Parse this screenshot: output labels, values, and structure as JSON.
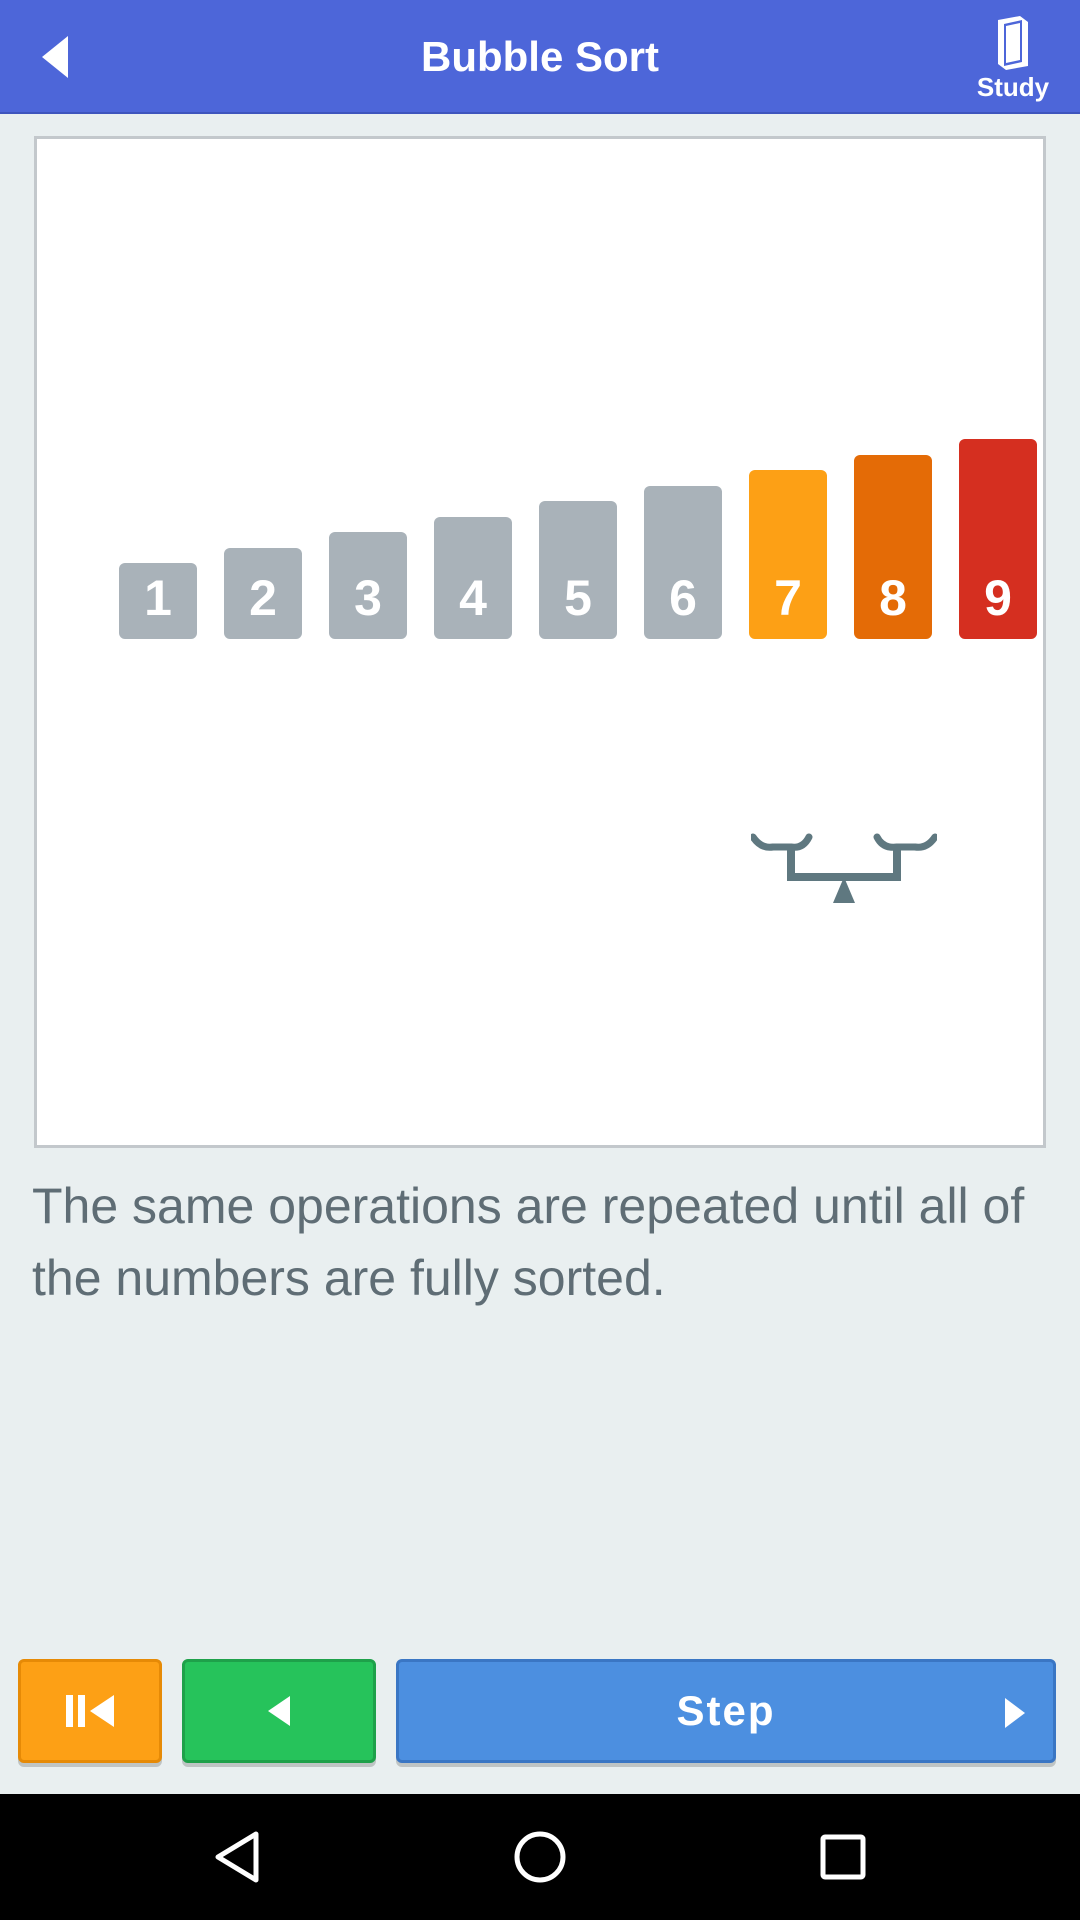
{
  "header": {
    "title": "Bubble Sort",
    "back_icon": "back-arrow-icon",
    "study_label": "Study",
    "study_icon": "book-icon"
  },
  "visualization": {
    "numbers": [
      {
        "label": "1",
        "value": 1,
        "color": "#a9b2b9"
      },
      {
        "label": "2",
        "value": 2,
        "color": "#a9b2b9"
      },
      {
        "label": "3",
        "value": 3,
        "color": "#a9b2b9"
      },
      {
        "label": "4",
        "value": 4,
        "color": "#a9b2b9"
      },
      {
        "label": "5",
        "value": 5,
        "color": "#a9b2b9"
      },
      {
        "label": "6",
        "value": 6,
        "color": "#a9b2b9"
      },
      {
        "label": "7",
        "value": 7,
        "color": "#fda015"
      },
      {
        "label": "8",
        "value": 8,
        "color": "#e46b06"
      },
      {
        "label": "9",
        "value": 9,
        "color": "#d52f20"
      }
    ],
    "scale_icon": "balance-scale-icon"
  },
  "caption": "The same operations are repeated until all of the numbers are fully sorted.",
  "controls": {
    "reset_icon": "skip-to-start-icon",
    "back_icon": "previous-triangle-icon",
    "step_label": "Step",
    "step_icon": "next-triangle-icon"
  },
  "navbar": {
    "back_icon": "nav-back-icon",
    "home_icon": "nav-home-icon",
    "recents_icon": "nav-recents-icon"
  },
  "colors": {
    "header": "#4d66d9",
    "reset_button": "#fda015",
    "back_button": "#26c35b",
    "step_button": "#4c8fe0"
  }
}
